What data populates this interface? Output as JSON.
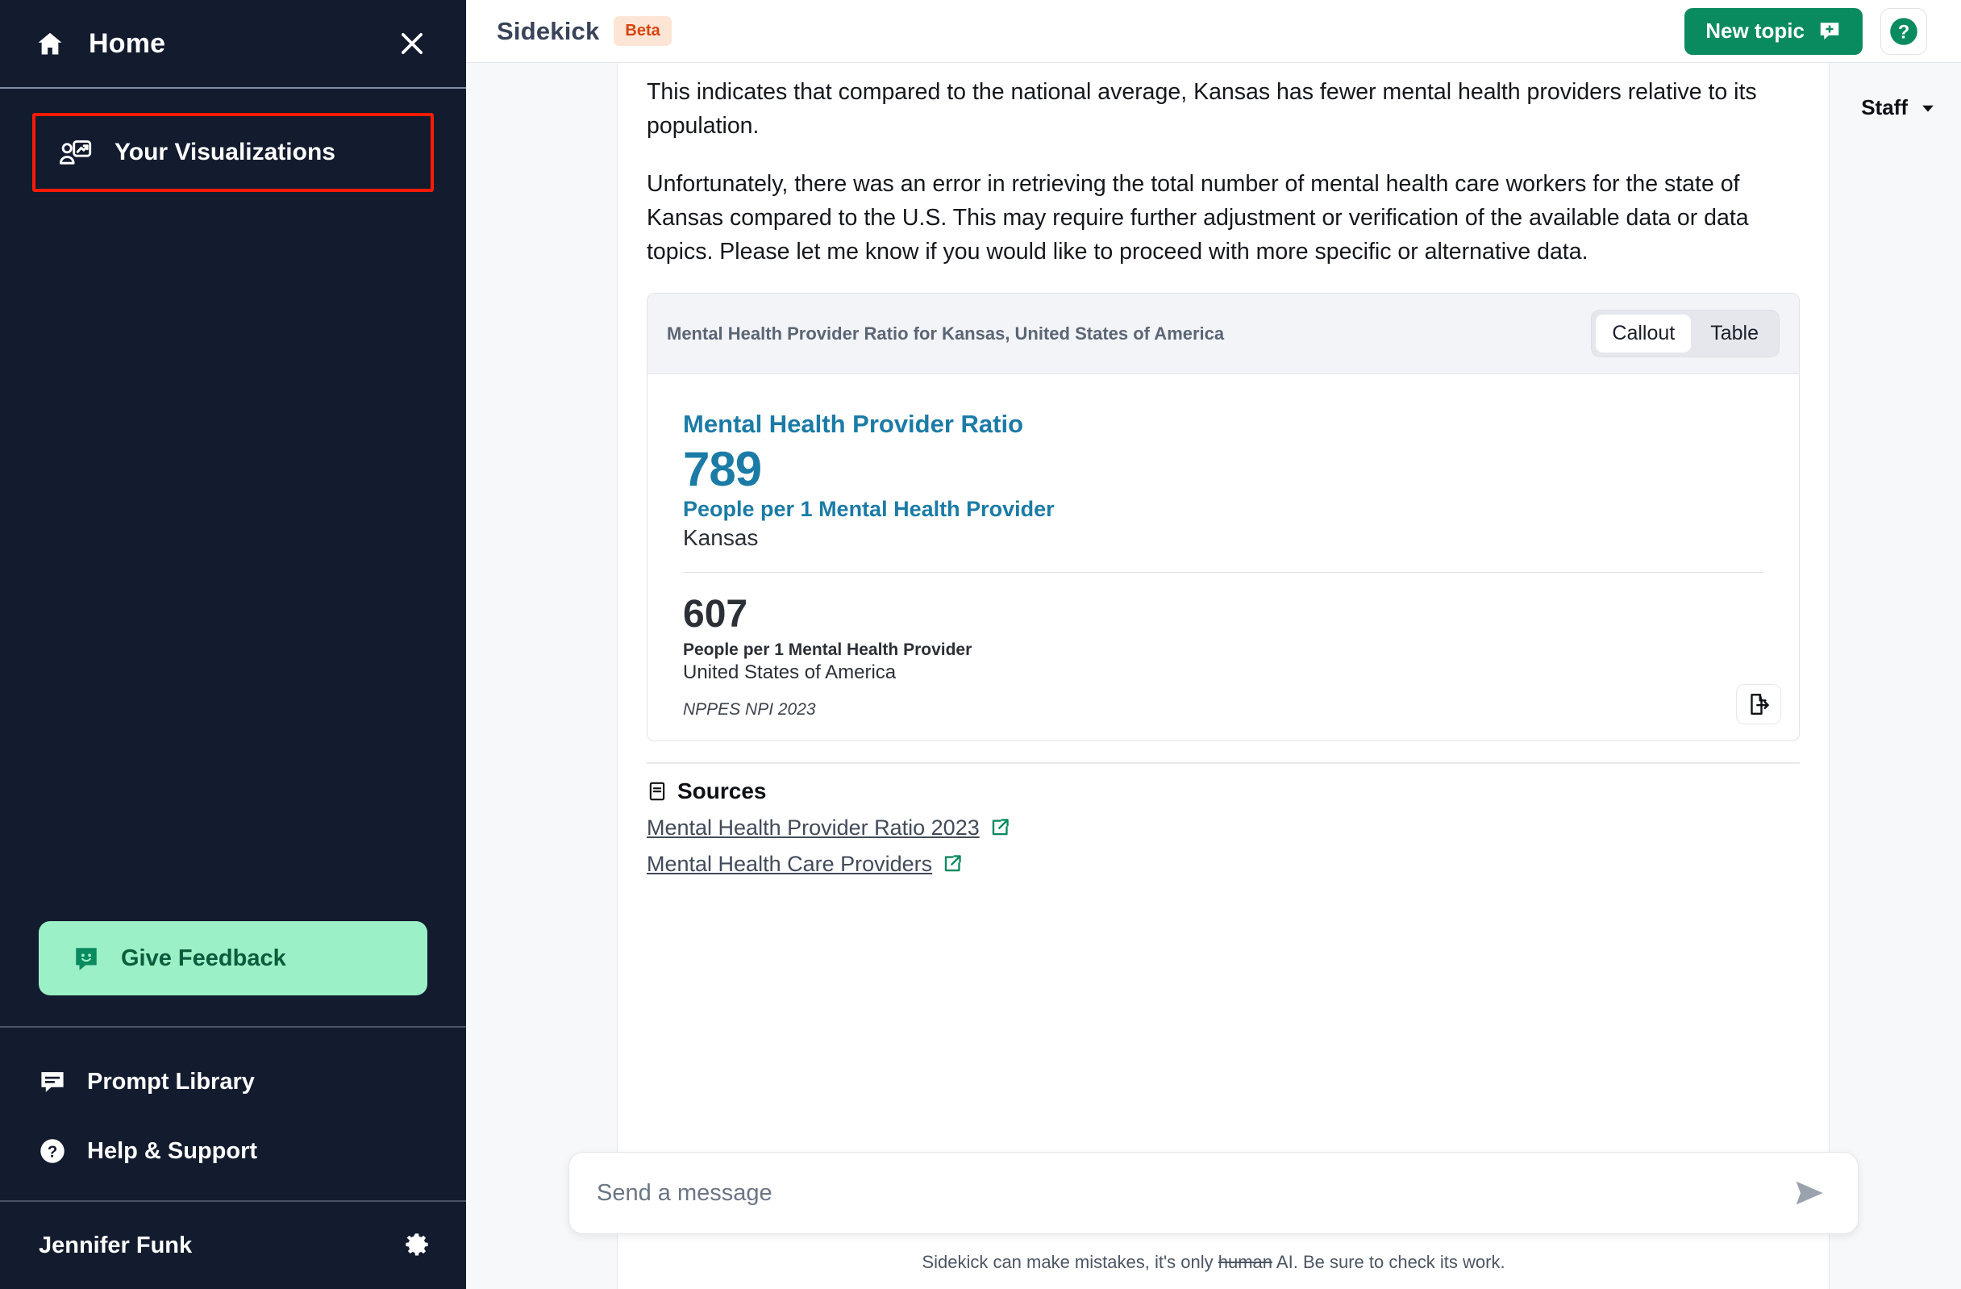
{
  "sidebar": {
    "home_label": "Home",
    "close_icon": "close-icon",
    "home_icon": "home-icon",
    "nav": [
      {
        "label": "Your Visualizations",
        "icon": "user-presentation-icon",
        "highlighted": true
      }
    ],
    "feedback": {
      "label": "Give Feedback",
      "icon": "smiley-chat-icon"
    },
    "links": [
      {
        "label": "Prompt Library",
        "icon": "chat-lines-icon"
      },
      {
        "label": "Help & Support",
        "icon": "question-circle-icon"
      }
    ],
    "user": {
      "name": "Jennifer Funk",
      "settings_icon": "gear-icon"
    }
  },
  "topbar": {
    "brand": "Sidekick",
    "badge": "Beta",
    "new_topic_label": "New topic",
    "new_topic_icon": "chat-plus-icon",
    "help_icon": "question-mark-icon"
  },
  "right_panel": {
    "selector_label": "Staff",
    "selector_icon": "chevron-down-icon"
  },
  "conversation": {
    "paragraphs": [
      "This indicates that compared to the national average, Kansas has fewer mental health providers relative to its population.",
      "Unfortunately, there was an error in retrieving the total number of mental health care workers for the state of Kansas compared to the U.S. This may require further adjustment or verification of the available data or data topics. Please let me know if you would like to proceed with more specific or alternative data."
    ]
  },
  "viz_card": {
    "header_title": "Mental Health Provider Ratio for Kansas, United States of America",
    "view_toggle": {
      "options": [
        "Callout",
        "Table"
      ],
      "selected": "Callout"
    },
    "callout": {
      "metric_title": "Mental Health Provider Ratio",
      "primary_value": "789",
      "primary_unit": "People per 1 Mental Health Provider",
      "primary_place": "Kansas",
      "comparison_value": "607",
      "comparison_unit": "People per 1 Mental Health Provider",
      "comparison_place": "United States of America",
      "source_note": "NPPES NPI 2023"
    },
    "export_icon": "file-export-icon",
    "accent_color": "#1b7ba6"
  },
  "sources": {
    "heading": "Sources",
    "heading_icon": "document-lines-icon",
    "links": [
      {
        "label": "Mental Health Provider Ratio 2023",
        "icon": "external-link-icon"
      },
      {
        "label": "Mental Health Care Providers",
        "icon": "external-link-icon"
      }
    ]
  },
  "composer": {
    "placeholder": "Send a message",
    "value": "",
    "send_icon": "send-arrow-icon"
  },
  "footer": {
    "disclaimer_before": "Sidekick can make mistakes, it's only ",
    "disclaimer_struck": "human",
    "disclaimer_after": " AI. Be sure to check its work."
  },
  "colors": {
    "sidebar_bg": "#131b2e",
    "brand_green": "#0a8a5f",
    "feedback_green": "#9bf0c8",
    "highlight_red": "#ff1a05",
    "beta_bg": "#fde5d6",
    "beta_text": "#d9430d",
    "kpi_blue": "#1b7ba6"
  }
}
